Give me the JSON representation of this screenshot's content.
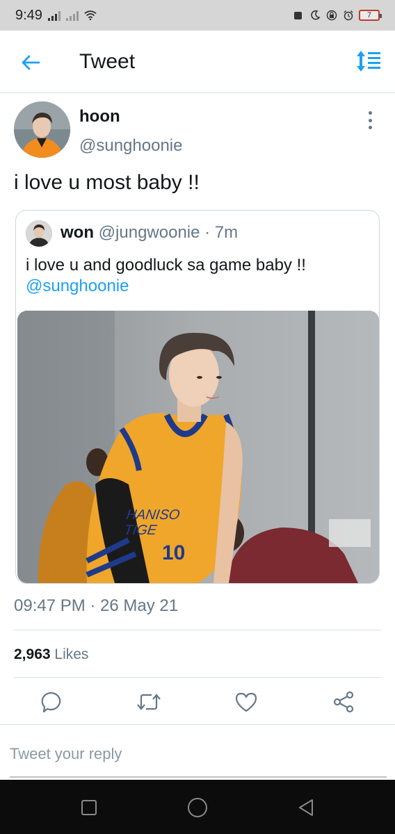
{
  "status_bar": {
    "time": "9:49",
    "battery": "7"
  },
  "header": {
    "title": "Tweet"
  },
  "tweet": {
    "author_name": "hoon",
    "author_handle": "@sunghoonie",
    "text": "i love u most baby !!",
    "timestamp": "09:47 PM · 26 May 21",
    "likes_count": "2,963",
    "likes_label": "Likes"
  },
  "quoted_tweet": {
    "author_name": "won",
    "author_handle": "@jungwoonie",
    "age": "· 7m",
    "text": "i love u and goodluck sa game baby !!",
    "mention": "@sunghoonie",
    "photo_jersey_text": "HANISO TIGE 10"
  },
  "reply": {
    "placeholder": "Tweet your reply"
  },
  "colors": {
    "accent": "#1da1f2",
    "secondary_text": "#657786",
    "primary_text": "#14171a"
  },
  "icons": {
    "back": "arrow-left-icon",
    "sort": "sort-icon",
    "more": "more-vertical-icon",
    "reply": "reply-icon",
    "retweet": "retweet-icon",
    "like": "heart-icon",
    "share": "share-icon"
  }
}
